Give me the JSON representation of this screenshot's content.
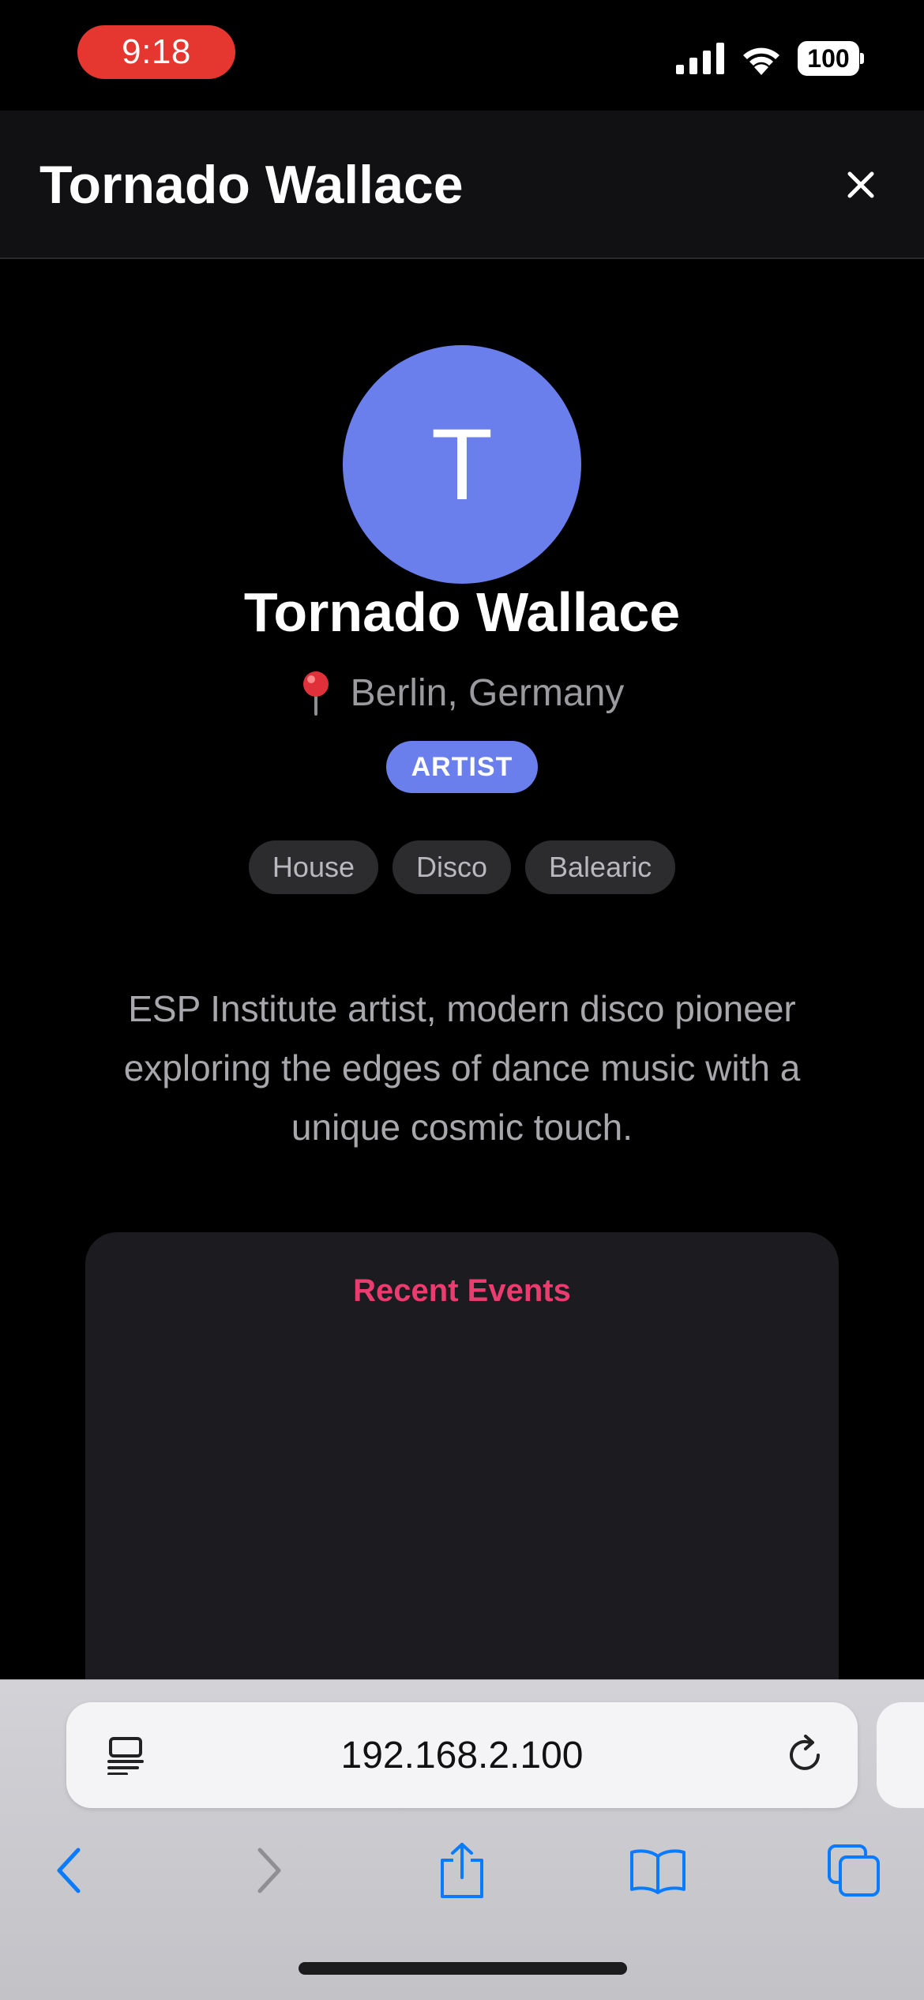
{
  "status_bar": {
    "time": "9:18",
    "battery": "100",
    "icons": [
      "signal-icon",
      "wifi-icon",
      "battery-icon"
    ]
  },
  "header": {
    "title": "Tornado Wallace",
    "close_icon": "close-icon"
  },
  "profile": {
    "avatar_initial": "T",
    "avatar_color": "#6a7fec",
    "name": "Tornado Wallace",
    "location_icon": "pin-icon",
    "location": "Berlin, Germany",
    "role": "ARTIST",
    "genres": [
      "House",
      "Disco",
      "Balearic"
    ],
    "bio": "ESP Institute artist, modern disco pioneer exploring the edges of dance music with a unique cosmic touch."
  },
  "events": {
    "title": "Recent Events",
    "title_color": "#ea3c6f"
  },
  "browser": {
    "url": "192.168.2.100",
    "icons": [
      "page-menu-icon",
      "reload-icon",
      "back-icon",
      "forward-icon",
      "share-icon",
      "bookmarks-icon",
      "tabs-icon"
    ],
    "accent": "#0a7aff"
  }
}
